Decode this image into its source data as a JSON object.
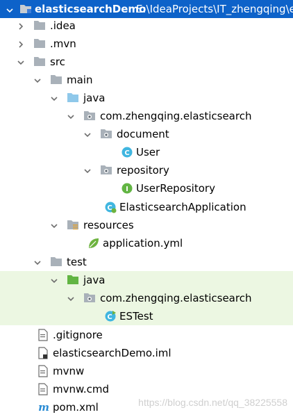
{
  "project": {
    "name": "elasticsearchDemo",
    "path": "E:\\IdeaProjects\\IT_zhengqing\\e"
  },
  "tree": [
    {
      "label": ".idea",
      "icon": "folder-icon",
      "expanded": false
    },
    {
      "label": ".mvn",
      "icon": "folder-icon",
      "expanded": false
    },
    {
      "label": "src",
      "icon": "folder-icon",
      "expanded": true
    },
    {
      "label": "main",
      "icon": "folder-icon",
      "expanded": true
    },
    {
      "label": "java",
      "icon": "source-folder-icon",
      "expanded": true
    },
    {
      "label": "com.zhengqing.elasticsearch",
      "icon": "package-icon",
      "expanded": true
    },
    {
      "label": "document",
      "icon": "package-icon",
      "expanded": true
    },
    {
      "label": "User",
      "icon": "class-icon"
    },
    {
      "label": "repository",
      "icon": "package-icon",
      "expanded": true
    },
    {
      "label": "UserRepository",
      "icon": "interface-icon"
    },
    {
      "label": "ElasticsearchApplication",
      "icon": "spring-boot-class-icon"
    },
    {
      "label": "resources",
      "icon": "resources-folder-icon",
      "expanded": true
    },
    {
      "label": "application.yml",
      "icon": "spring-config-icon"
    },
    {
      "label": "test",
      "icon": "folder-icon",
      "expanded": true
    },
    {
      "label": "java",
      "icon": "test-source-folder-icon",
      "expanded": true
    },
    {
      "label": "com.zhengqing.elasticsearch",
      "icon": "package-icon",
      "expanded": true
    },
    {
      "label": "ESTest",
      "icon": "test-class-icon"
    },
    {
      "label": ".gitignore",
      "icon": "text-file-icon"
    },
    {
      "label": "elasticsearchDemo.iml",
      "icon": "module-file-icon"
    },
    {
      "label": "mvnw",
      "icon": "text-file-icon"
    },
    {
      "label": "mvnw.cmd",
      "icon": "text-file-icon"
    },
    {
      "label": "pom.xml",
      "icon": "maven-icon"
    }
  ],
  "watermark": "https://blog.csdn.net/qq_38225558",
  "colors": {
    "selection": "#0d62c9",
    "test_highlight": "#ecf7e2",
    "folder": "#a9b1b9",
    "source_folder": "#8fc8ea",
    "test_folder": "#62b543",
    "class": "#40b6e0",
    "interface": "#62b543",
    "spring": "#6db33f",
    "maven": "#2b8cd4"
  }
}
